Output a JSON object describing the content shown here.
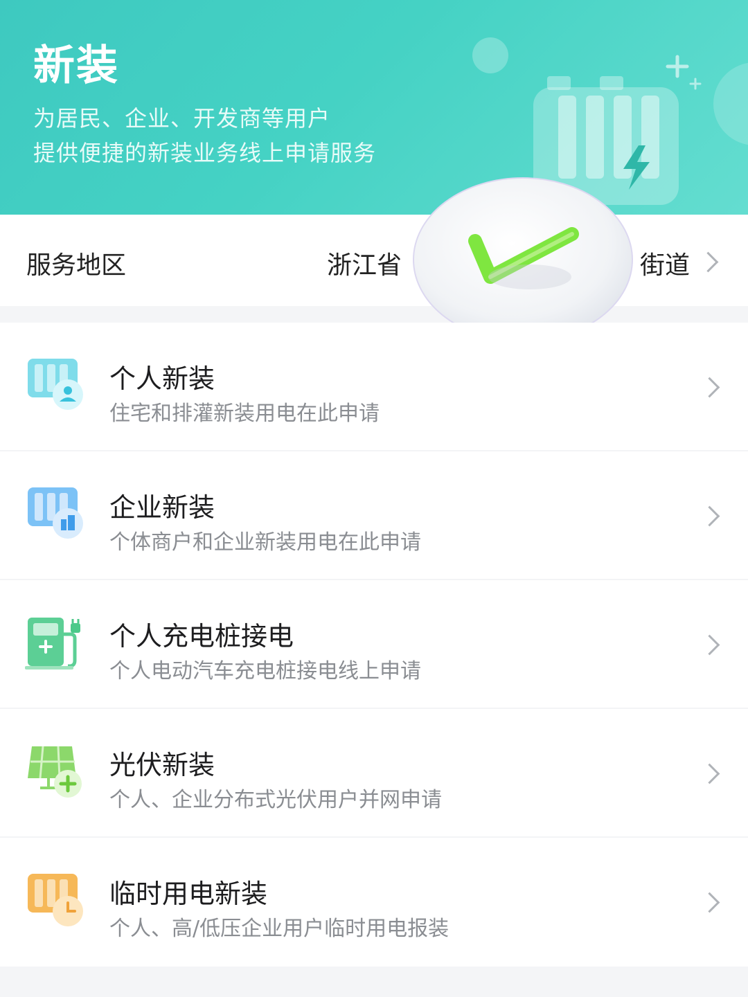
{
  "header": {
    "title": "新装",
    "subtitle_line1": "为居民、企业、开发商等用户",
    "subtitle_line2": "提供便捷的新装业务线上申请服务"
  },
  "region": {
    "label": "服务地区",
    "province": "浙江省",
    "street": "街道"
  },
  "services": [
    {
      "title": "个人新装",
      "desc": "住宅和排灌新装用电在此申请",
      "icon": "personal-install-icon"
    },
    {
      "title": "企业新装",
      "desc": "个体商户和企业新装用电在此申请",
      "icon": "enterprise-install-icon"
    },
    {
      "title": "个人充电桩接电",
      "desc": "个人电动汽车充电桩接电线上申请",
      "icon": "charging-pile-icon"
    },
    {
      "title": "光伏新装",
      "desc": "个人、企业分布式光伏用户并网申请",
      "icon": "solar-install-icon"
    },
    {
      "title": "临时用电新装",
      "desc": "个人、高/低压企业用户临时用电报装",
      "icon": "temporary-power-icon"
    }
  ],
  "colors": {
    "hero": "#45d2c4",
    "personal": "#62d3e6",
    "enterprise": "#6bb8f4",
    "charging": "#4cc98a",
    "solar": "#8ed86a",
    "temporary": "#f5b255"
  }
}
